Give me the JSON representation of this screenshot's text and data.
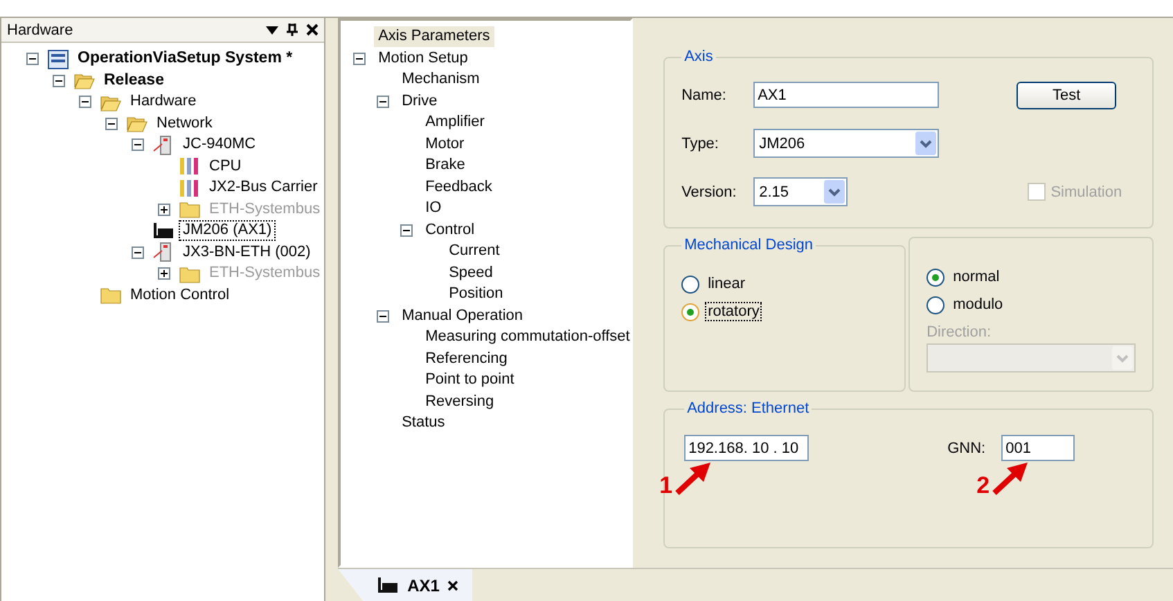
{
  "hardware_panel": {
    "title": "Hardware"
  },
  "hardware_tree": [
    {
      "label": "OperationViaSetup System *",
      "kind": "system",
      "bold": true,
      "disabled": false,
      "selected": false,
      "expanded": true,
      "children": [
        {
          "label": "Release",
          "kind": "folder-open",
          "bold": true,
          "disabled": false,
          "selected": false,
          "expanded": true,
          "children": [
            {
              "label": "Hardware",
              "kind": "folder-open",
              "bold": false,
              "disabled": false,
              "selected": false,
              "expanded": true,
              "children": [
                {
                  "label": "Network",
                  "kind": "folder-open",
                  "bold": false,
                  "disabled": false,
                  "selected": false,
                  "expanded": true,
                  "children": [
                    {
                      "label": "JC-940MC",
                      "kind": "device",
                      "bold": false,
                      "disabled": false,
                      "selected": false,
                      "expanded": true,
                      "children": [
                        {
                          "label": "CPU",
                          "kind": "module",
                          "bold": false,
                          "disabled": false,
                          "selected": false
                        },
                        {
                          "label": "JX2-Bus Carrier",
                          "kind": "module",
                          "bold": false,
                          "disabled": false,
                          "selected": false
                        },
                        {
                          "label": "ETH-Systembus",
                          "kind": "folder",
                          "bold": false,
                          "disabled": true,
                          "selected": false,
                          "expanded": false
                        }
                      ]
                    },
                    {
                      "label": "JM206 (AX1)",
                      "kind": "axis",
                      "bold": false,
                      "disabled": false,
                      "selected": true
                    },
                    {
                      "label": "JX3-BN-ETH (002)",
                      "kind": "device",
                      "bold": false,
                      "disabled": false,
                      "selected": false,
                      "expanded": true,
                      "children": [
                        {
                          "label": "ETH-Systembus",
                          "kind": "folder",
                          "bold": false,
                          "disabled": true,
                          "selected": false,
                          "expanded": false
                        }
                      ]
                    }
                  ]
                }
              ]
            },
            {
              "label": "Motion Control",
              "kind": "folder",
              "bold": false,
              "disabled": false,
              "selected": false
            }
          ]
        }
      ]
    }
  ],
  "setup_tree": [
    {
      "label": "Axis Parameters",
      "selected": true
    },
    {
      "label": "Motion Setup",
      "selected": false,
      "expanded": true,
      "children": [
        {
          "label": "Mechanism",
          "selected": false
        },
        {
          "label": "Drive",
          "selected": false,
          "expanded": true,
          "children": [
            {
              "label": "Amplifier",
              "selected": false
            },
            {
              "label": "Motor",
              "selected": false
            },
            {
              "label": "Brake",
              "selected": false
            },
            {
              "label": "Feedback",
              "selected": false
            },
            {
              "label": "IO",
              "selected": false
            },
            {
              "label": "Control",
              "selected": false,
              "expanded": true,
              "children": [
                {
                  "label": "Current",
                  "selected": false
                },
                {
                  "label": "Speed",
                  "selected": false
                },
                {
                  "label": "Position",
                  "selected": false
                }
              ]
            }
          ]
        },
        {
          "label": "Manual Operation",
          "selected": false,
          "expanded": true,
          "children": [
            {
              "label": "Measuring commutation-offset",
              "selected": false
            },
            {
              "label": "Referencing",
              "selected": false
            },
            {
              "label": "Point to point",
              "selected": false
            },
            {
              "label": "Reversing",
              "selected": false
            }
          ]
        },
        {
          "label": "Status",
          "selected": false
        }
      ]
    }
  ],
  "axis": {
    "title": "Axis",
    "name": {
      "label": "Name:",
      "value": "AX1"
    },
    "type": {
      "label": "Type:",
      "value": "JM206"
    },
    "version": {
      "label": "Version:",
      "value": "2.15"
    },
    "test_button": "Test",
    "simulation": {
      "label": "Simulation",
      "checked": false,
      "disabled": true
    }
  },
  "mechanical_design": {
    "title": "Mechanical Design",
    "motion": [
      {
        "label": "linear",
        "selected": false,
        "focused": false
      },
      {
        "label": "rotatory",
        "selected": true,
        "focused": true
      }
    ],
    "range": [
      {
        "label": "normal",
        "selected": true
      },
      {
        "label": "modulo",
        "selected": false
      }
    ],
    "direction": {
      "label": "Direction:",
      "disabled": true
    }
  },
  "address": {
    "title": "Address: Ethernet",
    "ip": "192.168. 10 . 10",
    "gnn": {
      "label": "GNN:",
      "value": "001"
    }
  },
  "annotations": [
    {
      "number": "1"
    },
    {
      "number": "2"
    }
  ],
  "document_tab": {
    "label": "AX1",
    "selected": true
  }
}
